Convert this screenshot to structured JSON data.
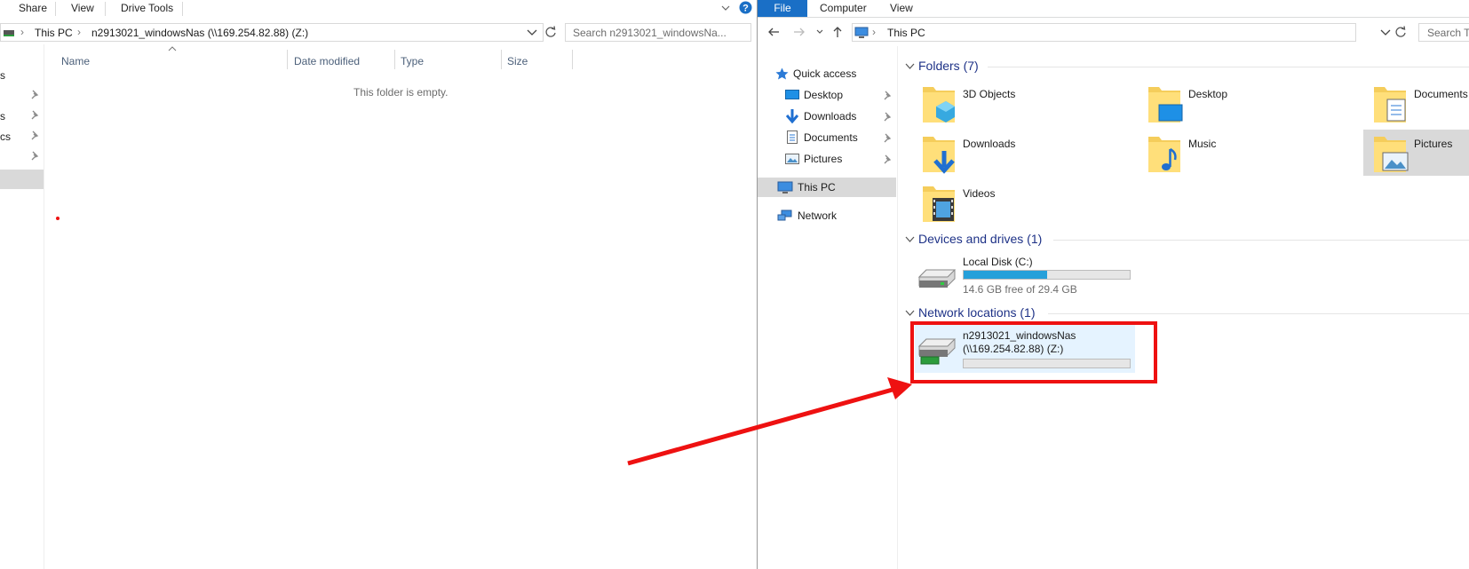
{
  "left": {
    "ribbon_tabs": [
      "Share",
      "View",
      "Drive Tools"
    ],
    "breadcrumb": [
      "This PC",
      "n2913021_windowsNas (\\\\169.254.82.88) (Z:)"
    ],
    "search_placeholder": "Search n2913021_windowsNa...",
    "columns": [
      "Name",
      "Date modified",
      "Type",
      "Size"
    ],
    "empty_message": "This folder is empty.",
    "partial_nav": [
      "s",
      "s",
      "cs"
    ]
  },
  "right": {
    "ribbon_tabs": [
      "File",
      "Computer",
      "View"
    ],
    "breadcrumb": "This PC",
    "search_placeholder": "Search Th",
    "nav": {
      "quick_access": "Quick access",
      "pinned": [
        "Desktop",
        "Downloads",
        "Documents",
        "Pictures"
      ],
      "this_pc": "This PC",
      "network": "Network"
    },
    "folders_header": "Folders (7)",
    "folders": [
      "3D Objects",
      "Desktop",
      "Documents",
      "Downloads",
      "Music",
      "Pictures",
      "Videos"
    ],
    "devices_header": "Devices and drives (1)",
    "local_disk": {
      "name": "Local Disk (C:)",
      "free": "14.6 GB free of 29.4 GB",
      "used_fraction": 0.5
    },
    "network_header": "Network locations (1)",
    "network_drive": {
      "name_line1": "n2913021_windowsNas",
      "name_line2": "(\\\\169.254.82.88) (Z:)",
      "used_fraction": 0.0
    }
  },
  "colors": {
    "accent": "#1a6fc6",
    "annotation": "#ee1111",
    "selection": "#cce8ff",
    "drive_bar": "#26a0da"
  },
  "icons": [
    "chevron-down-icon",
    "help-icon",
    "refresh-icon",
    "back-arrow-icon",
    "forward-arrow-icon",
    "up-arrow-icon",
    "pc-icon",
    "pin-icon",
    "folder-icon",
    "hdd-icon",
    "network-drive-icon",
    "star-icon",
    "network-icon"
  ]
}
